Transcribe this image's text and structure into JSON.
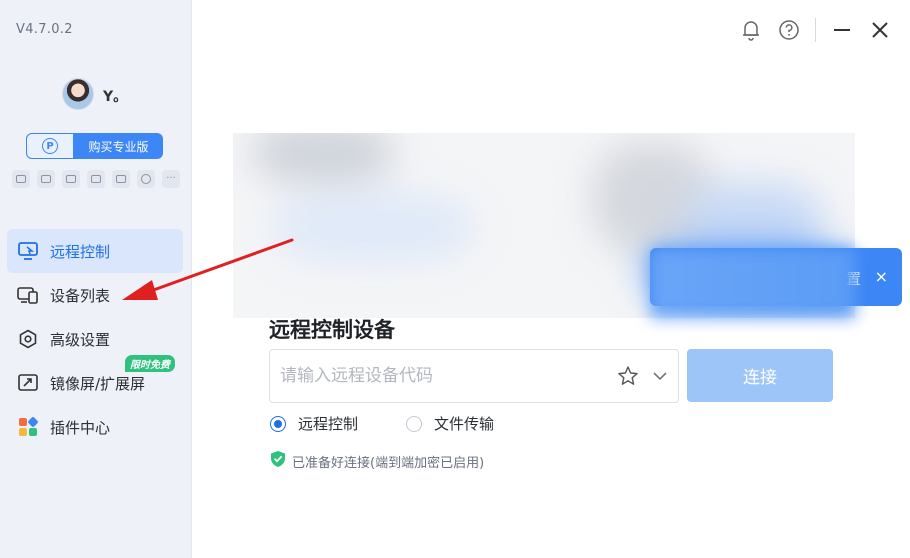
{
  "app": {
    "version": "V4.7.0.2"
  },
  "user": {
    "name": "Y。"
  },
  "pro": {
    "label": "购买专业版",
    "icon_letter": "P"
  },
  "toolbar_icons": [
    "gamepad-icon",
    "monitor-icon",
    "image-icon",
    "screen-icon",
    "upload-icon",
    "circle-icon",
    "more-icon"
  ],
  "sidebar": {
    "items": [
      {
        "label": "远程控制",
        "icon": "remote-control-icon",
        "active": true
      },
      {
        "label": "设备列表",
        "icon": "device-list-icon",
        "active": false
      },
      {
        "label": "高级设置",
        "icon": "hexagon-settings-icon",
        "active": false
      },
      {
        "label": "镜像屏/扩展屏",
        "icon": "mirror-screen-icon",
        "active": false,
        "badge": "限时免费"
      },
      {
        "label": "插件中心",
        "icon": "plugin-icon",
        "active": false
      }
    ]
  },
  "topbar": {
    "icons": [
      "bell-icon",
      "help-icon",
      "minimize-icon",
      "close-icon"
    ]
  },
  "banner": {
    "partial_text": "置",
    "close": "×"
  },
  "main": {
    "section_title": "远程控制设备",
    "code_input": {
      "placeholder": "请输入远程设备代码",
      "value": ""
    },
    "connect_label": "连接",
    "modes": [
      {
        "label": "远程控制",
        "checked": true
      },
      {
        "label": "文件传输",
        "checked": false
      }
    ],
    "status": "已准备好连接(端到端加密已启用)"
  },
  "colors": {
    "accent": "#1f6fe5",
    "primary_button": "#3d86f5",
    "connect_disabled": "#9ec5f8",
    "success": "#2ec27e",
    "sidebar_bg": "#eef1f7",
    "annotation_arrow": "#e02020"
  }
}
